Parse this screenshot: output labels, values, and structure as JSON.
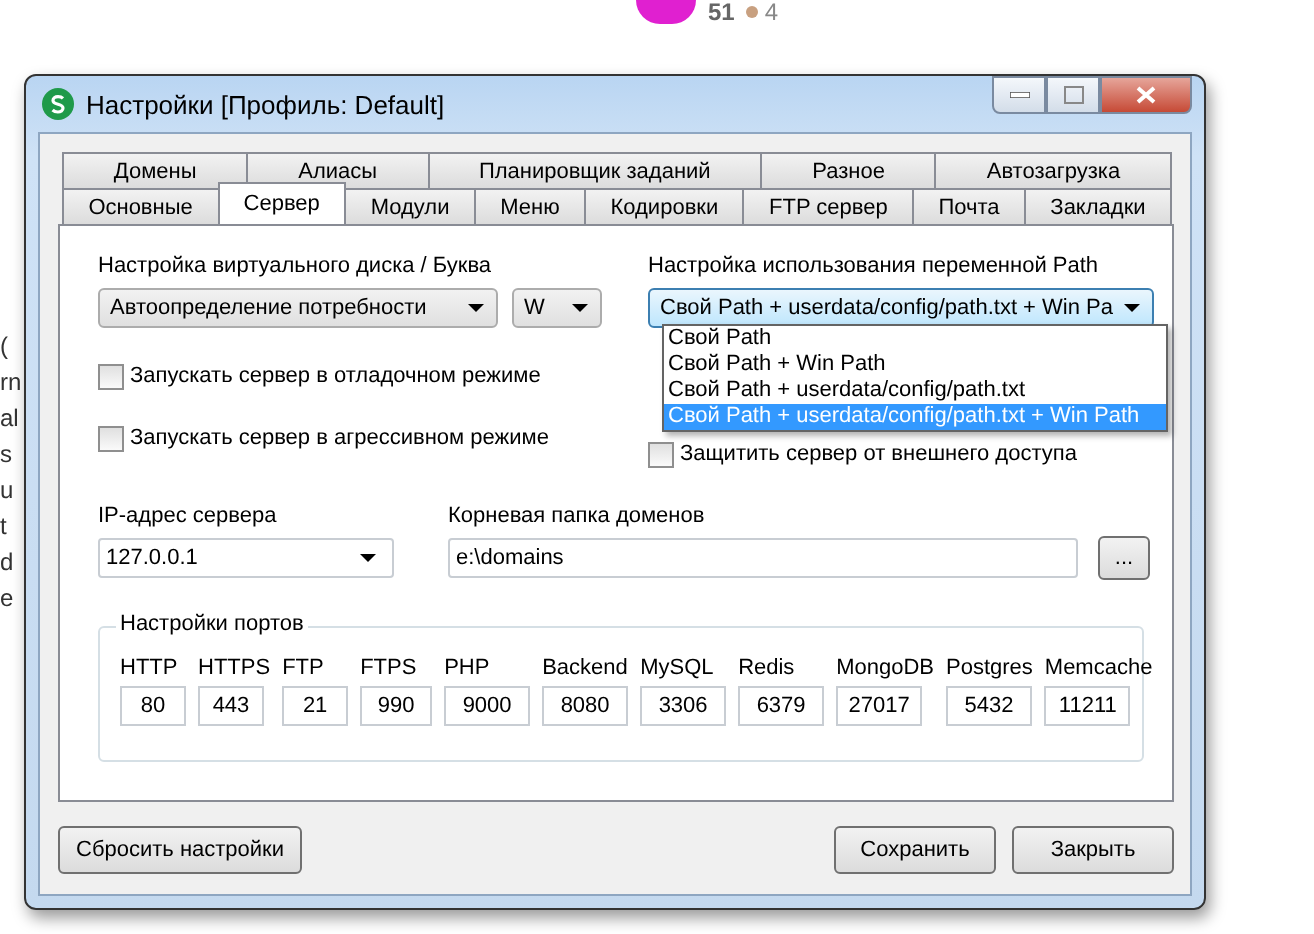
{
  "page": {
    "score": "51",
    "badge_count": "4",
    "edge_fragments": [
      "(",
      "rn",
      "al",
      "s",
      "u",
      "t",
      "d",
      "e"
    ]
  },
  "window": {
    "title": "Настройки [Профиль: Default]"
  },
  "tab_rows": [
    [
      {
        "label": "Домены",
        "selected": false
      },
      {
        "label": "Алиасы",
        "selected": false
      },
      {
        "label": "Планировщик заданий",
        "selected": false
      },
      {
        "label": "Разное",
        "selected": false
      },
      {
        "label": "Автозагрузка",
        "selected": false
      }
    ],
    [
      {
        "label": "Основные",
        "selected": false
      },
      {
        "label": "Сервер",
        "selected": true
      },
      {
        "label": "Модули",
        "selected": false
      },
      {
        "label": "Меню",
        "selected": false
      },
      {
        "label": "Кодировки",
        "selected": false
      },
      {
        "label": "FTP сервер",
        "selected": false
      },
      {
        "label": "Почта",
        "selected": false
      },
      {
        "label": "Закладки",
        "selected": false
      }
    ]
  ],
  "virtual_disk": {
    "label": "Настройка виртуального диска / Буква",
    "mode": "Автоопределение потребности",
    "letter": "W"
  },
  "left_checkboxes": [
    {
      "label": "Запускать сервер в отладочном режиме",
      "checked": false
    },
    {
      "label": "Запускать сервер в агрессивном режиме",
      "checked": false
    }
  ],
  "path_setting": {
    "label": "Настройка использования переменной Path",
    "value": "Свой Path + userdata/config/path.txt + Win Pa",
    "expanded": true,
    "options": [
      {
        "label": "Свой Path",
        "selected": false
      },
      {
        "label": "Свой Path + Win Path",
        "selected": false
      },
      {
        "label": "Свой Path + userdata/config/path.txt",
        "selected": false
      },
      {
        "label": "Свой Path + userdata/config/path.txt + Win Path",
        "selected": true
      }
    ]
  },
  "right_checkbox": {
    "label": "Защитить сервер от внешнего доступа",
    "checked": false
  },
  "server_ip": {
    "label": "IP-адрес сервера",
    "value": "127.0.0.1"
  },
  "domains_root": {
    "label": "Корневая папка доменов",
    "value": "e:\\domains",
    "browse": "..."
  },
  "ports": {
    "title": "Настройки портов",
    "items": [
      {
        "name": "HTTP",
        "value": "80"
      },
      {
        "name": "HTTPS",
        "value": "443"
      },
      {
        "name": "FTP",
        "value": "21"
      },
      {
        "name": "FTPS",
        "value": "990"
      },
      {
        "name": "PHP",
        "value": "9000"
      },
      {
        "name": "Backend",
        "value": "8080"
      },
      {
        "name": "MySQL",
        "value": "3306"
      },
      {
        "name": "Redis",
        "value": "6379"
      },
      {
        "name": "MongoDB",
        "value": "27017"
      },
      {
        "name": "Postgres",
        "value": "5432"
      },
      {
        "name": "Memcache",
        "value": "11211"
      }
    ]
  },
  "buttons": {
    "reset": "Сбросить настройки",
    "save": "Сохранить",
    "close": "Закрыть"
  }
}
